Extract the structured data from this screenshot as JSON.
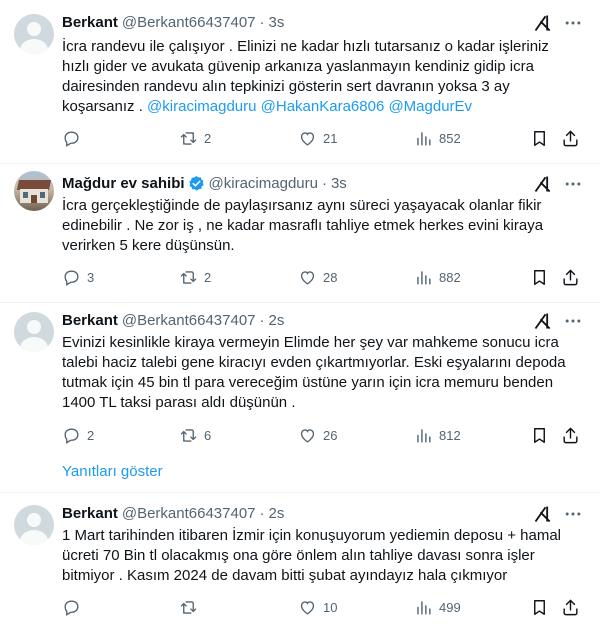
{
  "tweets": [
    {
      "name": "Berkant",
      "handle": "@Berkant66437407",
      "time": "3s",
      "verified": false,
      "text_lines": [
        "İcra randevu ile çalışıyor . Elinizi ne kadar hızlı tutarsanız o kadar işleriniz",
        "hızlı gider ve avukata güvenip arkanıza yaslanmayın kendiniz gidip icra",
        "dairesinden randevu alın tepkinizi gösterin sert davranın yoksa 3 ay",
        "koşarsanız . "
      ],
      "mentions": "@kiracimagduru @HakanKara6806 @MagdurEv",
      "replies": "",
      "retweets": "2",
      "likes": "21",
      "views": "852"
    },
    {
      "name": "Mağdur ev sahibi",
      "handle": "@kiracimagduru",
      "time": "3s",
      "verified": true,
      "text_lines": [
        "İcra gerçekleştiğinde de paylaşırsanız aynı süreci yaşayacak olanlar fikir",
        "edinebilir . Ne zor iş , ne kadar masraflı tahliye etmek herkes evini kiraya",
        "verirken 5 kere düşünsün."
      ],
      "replies": "3",
      "retweets": "2",
      "likes": "28",
      "views": "882"
    },
    {
      "name": "Berkant",
      "handle": "@Berkant66437407",
      "time": "2s",
      "verified": false,
      "text_lines": [
        "Evinizi kesinlikle kiraya vermeyin Elimde her şey var mahkeme sonucu icra",
        "talebi haciz talebi gene kiracıyı evden çıkartmıyorlar. Eski eşyalarını depoda",
        "tutmak için 45 bin tl para vereceğim üstüne yarın için icra memuru benden",
        "1400 TL taksi parası aldı düşünün ."
      ],
      "replies": "2",
      "retweets": "6",
      "likes": "26",
      "views": "812"
    },
    {
      "name": "Berkant",
      "handle": "@Berkant66437407",
      "time": "2s",
      "verified": false,
      "text_lines": [
        "1 Mart tarihinden itibaren İzmir için konuşuyorum yediemin deposu + hamal",
        "ücreti 70 Bin tl olacakmış ona göre önlem alın tahliye davası sonra işler",
        "bitmiyor . Kasım 2024 de davam bitti şubat ayındayız hala çıkmıyor"
      ],
      "replies": "",
      "retweets": "",
      "likes": "10",
      "views": "499"
    }
  ],
  "show_replies_label": "Yanıtları göster",
  "icons": [
    "grok-icon",
    "more-icon",
    "reply-icon",
    "retweet-icon",
    "like-icon",
    "views-icon",
    "bookmark-icon",
    "share-icon",
    "verified-badge-icon"
  ],
  "colors": {
    "accent": "#1d9bf0",
    "muted": "#536471",
    "text": "#0f1419",
    "separator": "#eff3f4"
  }
}
